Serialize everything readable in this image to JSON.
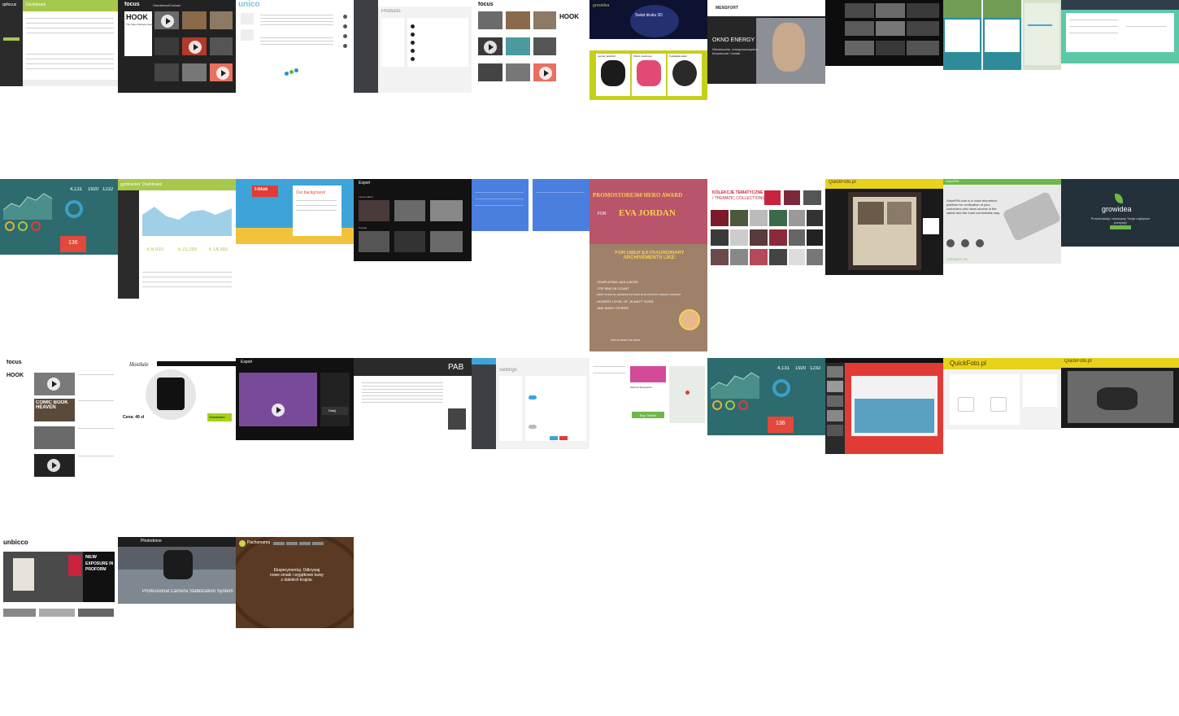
{
  "colors": {
    "green": "#a6c84c",
    "dark": "#1e1e1e",
    "teal": "#2e6b6e",
    "blue": "#4a7fe0",
    "red": "#e23b36",
    "yellow": "#e8d21c",
    "olive": "#c7cf1a",
    "mint": "#5cc8a8",
    "rose": "#c9626a"
  },
  "tiles": {
    "r1c1": {
      "logo": "qsfocus",
      "section": "Dashboard"
    },
    "r1c2": {
      "logo": "focus",
      "nav": [
        "Home",
        "About",
        "Contact",
        "Facebook page"
      ],
      "hero_title": "HOOK",
      "tagline": "The Video Website Sample Home"
    },
    "r1c3": {
      "logo": "unico"
    },
    "r1c4": {
      "section": "Products"
    },
    "r1c5": {
      "logo": "focus",
      "hero_title": "HOOK"
    },
    "r1c6": {
      "logo": "growidea",
      "hero_title": "Świat druku 3D",
      "cards": [
        "Lampa naddrzwi",
        "Wieża szachowa",
        "Podkładka kółek"
      ]
    },
    "r1c7": {
      "logo": "MENSFORT",
      "headline": "OKNO ENERGY",
      "tagline": "Niezawodne, energooszczędne bezpieczne i trwałe."
    },
    "r2c1": {
      "kpi_main": "4,131",
      "kpi_a": "1920",
      "kpi_b": "1232",
      "alert_value": "136"
    },
    "r2c2": {
      "logo": "gymtracker",
      "section": "Dashboard",
      "stat_1": "£ 6,910",
      "stat_2": "£ 21,293",
      "stat_3": "£ 14,392"
    },
    "r2c3": {
      "logo": "t-blue",
      "heading": "Our background"
    },
    "r2c4": {
      "logo": "Export",
      "rows": [
        "Latest Added",
        "Popular"
      ]
    },
    "r2c6": {
      "title_line": "PROMOSTORE360 HERO AWARD",
      "for": "FOR",
      "name": "EVA JORDAN",
      "subtitle": "FOR ÜBER EXTRAORDINARY ARCHIVEMENTS LIKE:",
      "items": [
        "-TEMPLATING LIKE A BOSS",
        "-TOP SING IN COUNT",
        "-FIRST PLACE IN „DRAWING KITTENS WITH HOTSPOT AREAS” CONTEST",
        "-HIGHEST LEVEL OF „W MATT” EVER",
        "-AND MANY OTHERS"
      ],
      "footer": "WITH ♥ FROM THE TEAM"
    },
    "r2c7": {
      "heading_1": "KOLEKCJE TEMATYCZNE",
      "heading_2": "/ THEMATIC COLLECTIONS"
    },
    "r2c8": {
      "logo": "QuickFoto.pl"
    },
    "r2c9": {
      "logo": "VoicePIN",
      "text": "VoicePIN.com is a voice biometrics platform for verification of your customers and users access in the safest and the most comfortable way.",
      "contact": "CONTACT US"
    },
    "r2c10": {
      "brand": "growidea",
      "tagline": "Porozmawiaj i zbudujmy Twoje najlepsze pomysły!"
    },
    "r3c1": {
      "logo": "focus",
      "hero_title": "HOOK",
      "card_title": "COMIC BOOK HEAVEN"
    },
    "r3c2": {
      "logo": "Hostlule",
      "price_label": "Cena: 49 zł",
      "button": "Zamawiam"
    },
    "r3c3": {
      "logo": "Export",
      "button": "Dalej"
    },
    "r3c4": {
      "logo": "PAB"
    },
    "r3c5": {
      "section": "Settings"
    },
    "r3c6": {
      "place": "Stanford Restaurant",
      "button": "Buy Tickets"
    },
    "r3c7": {
      "kpi_main": "4,131",
      "kpi_a": "1920",
      "kpi_b": "1232",
      "alert_value": "136"
    },
    "r3c9": {
      "logo": "QuickFoto.pl"
    },
    "r3c10": {
      "logo": "QuickFoto.pl"
    },
    "r4c1": {
      "logo": "unbicco",
      "headline_1": "NEW",
      "headline_2": "EXPOSURE IN",
      "headline_3": "PROFORM"
    },
    "r4c2": {
      "logo": "Photodrone",
      "caption": "Professional Camera Stabilization System"
    },
    "r4c3": {
      "logo": "Pachamama",
      "tagline": "Eksperymentuj. Odkrywaj nowe smaki i wyjątkowe kawy z dalekich krajów."
    }
  }
}
